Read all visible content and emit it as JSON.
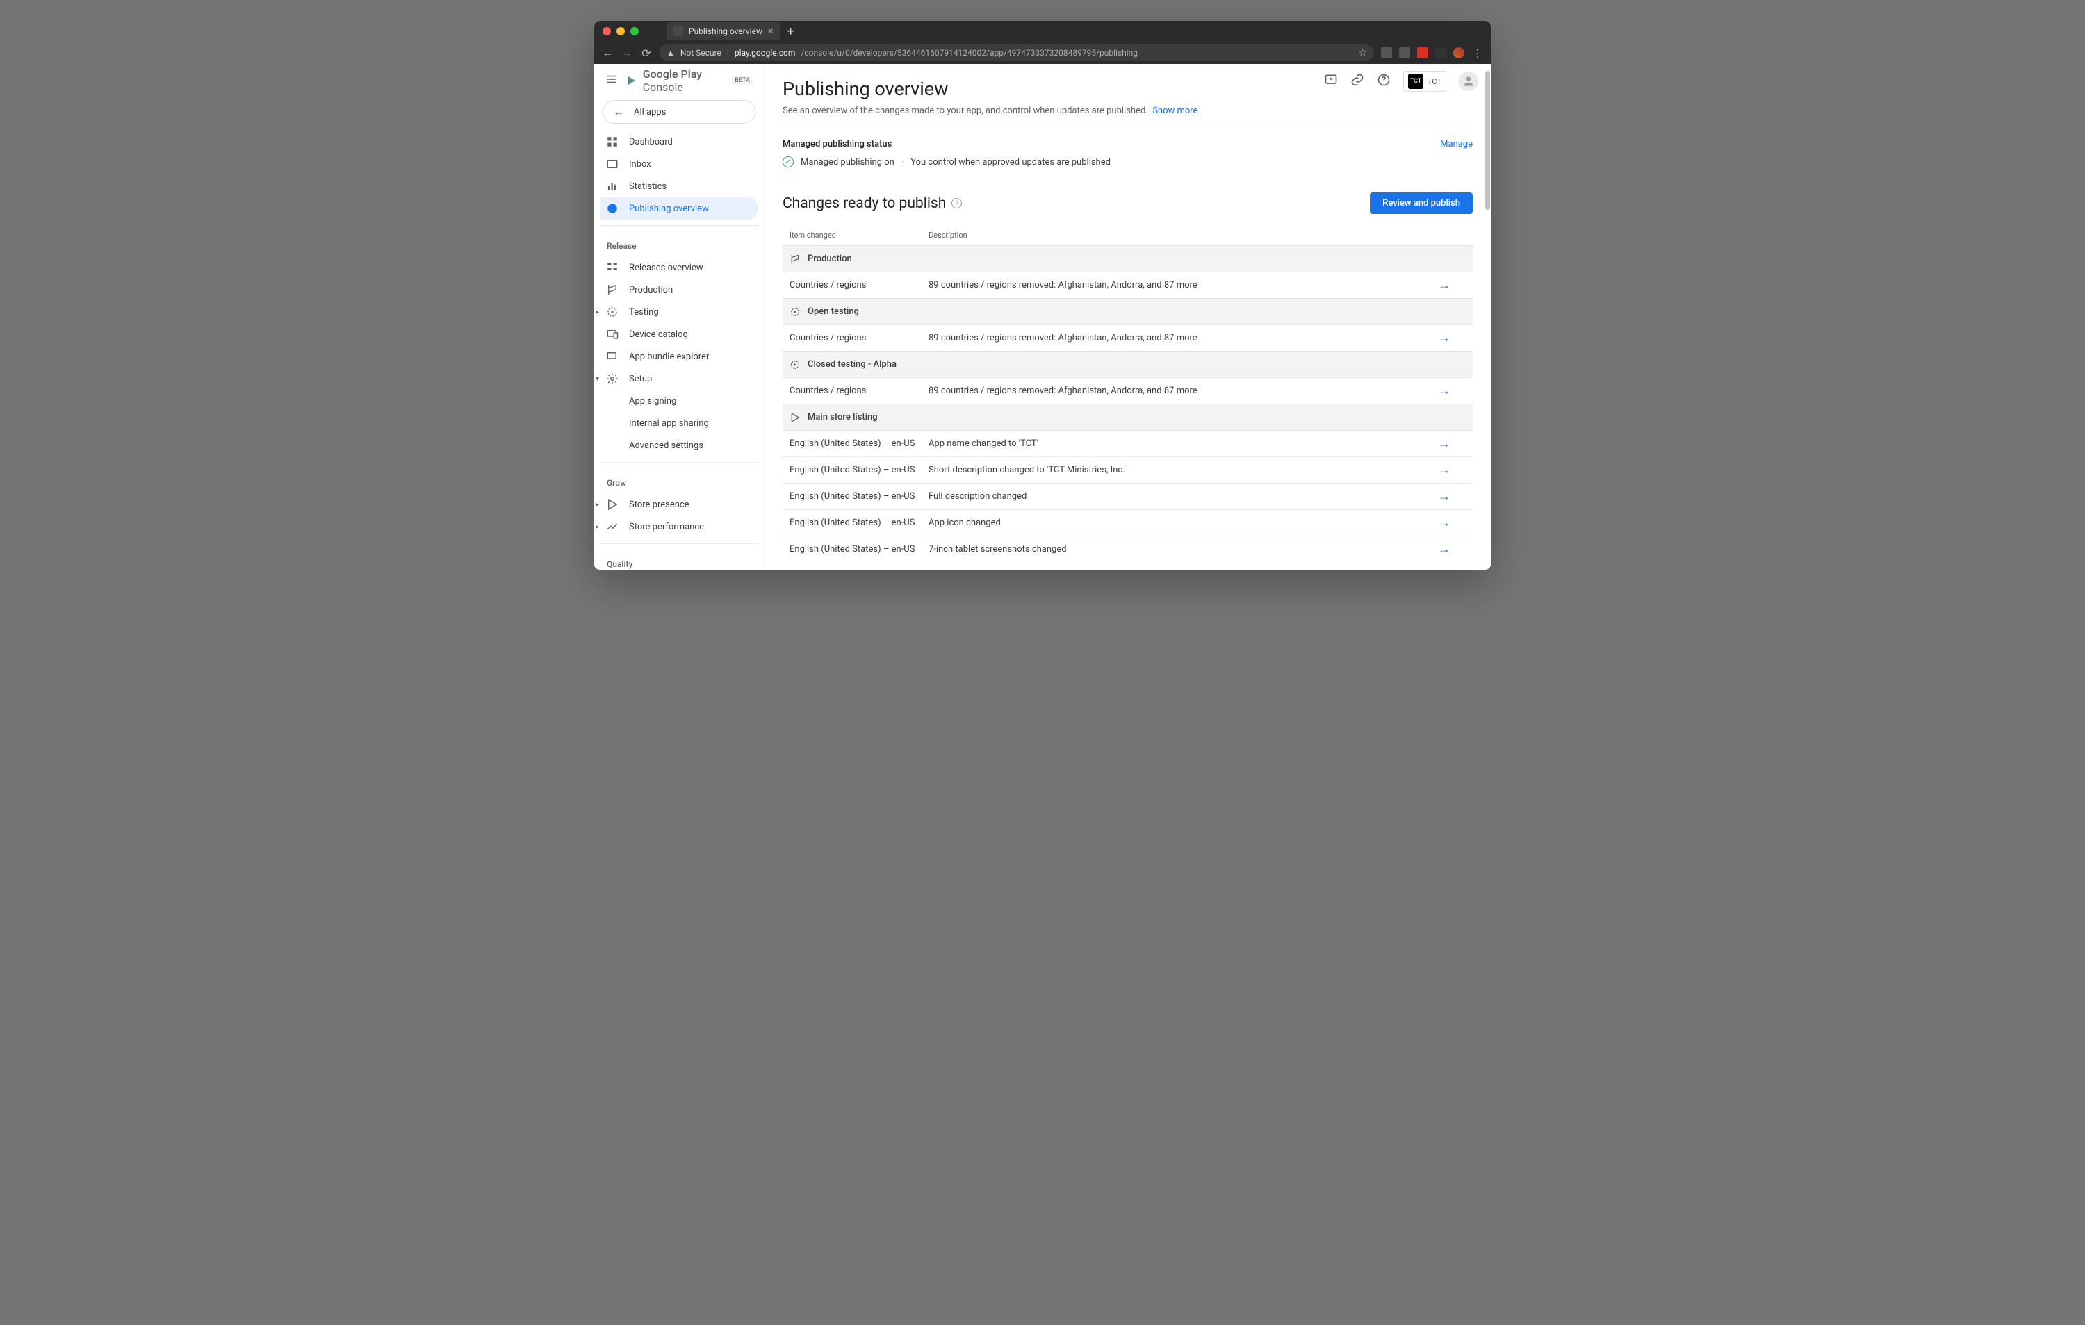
{
  "browser": {
    "tab_title": "Publishing overview",
    "security": "Not Secure",
    "url_domain": "play.google.com",
    "url_path": "/console/u/0/developers/5364461607914124002/app/4974733373208489795/publishing"
  },
  "header": {
    "product": "Google Play",
    "product_sub": "Console",
    "beta": "BETA",
    "all_apps": "All apps",
    "org_name": "TCT",
    "org_badge": "TCT"
  },
  "sidebar": {
    "items": {
      "dashboard": "Dashboard",
      "inbox": "Inbox",
      "statistics": "Statistics",
      "pub_overview": "Publishing overview"
    },
    "sections": {
      "release": "Release",
      "grow": "Grow",
      "quality": "Quality"
    },
    "release": {
      "rel_overview": "Releases overview",
      "production": "Production",
      "testing": "Testing",
      "device_catalog": "Device catalog",
      "bundle_explorer": "App bundle explorer",
      "setup": "Setup",
      "app_signing": "App signing",
      "internal_sharing": "Internal app sharing",
      "adv_settings": "Advanced settings"
    },
    "grow": {
      "store_presence": "Store presence",
      "store_perf": "Store performance"
    }
  },
  "page": {
    "title": "Publishing overview",
    "subtitle": "See an overview of the changes made to your app, and control when updates are published.",
    "show_more": "Show more",
    "status_title": "Managed publishing status",
    "status_on": "Managed publishing on",
    "status_detail": "You control when approved updates are published",
    "manage": "Manage",
    "changes_title": "Changes ready to publish",
    "review_btn": "Review and publish",
    "col_item": "Item changed",
    "col_desc": "Description"
  },
  "groups": [
    {
      "icon": "prod",
      "label": "Production",
      "rows": [
        {
          "item": "Countries / regions",
          "desc": "89 countries / regions removed: Afghanistan, Andorra, and 87 more"
        }
      ]
    },
    {
      "icon": "open",
      "label": "Open testing",
      "rows": [
        {
          "item": "Countries / regions",
          "desc": "89 countries / regions removed: Afghanistan, Andorra, and 87 more"
        }
      ]
    },
    {
      "icon": "closed",
      "label": "Closed testing - Alpha",
      "rows": [
        {
          "item": "Countries / regions",
          "desc": "89 countries / regions removed: Afghanistan, Andorra, and 87 more"
        }
      ]
    },
    {
      "icon": "store",
      "label": "Main store listing",
      "rows": [
        {
          "item": "English (United States) – en-US",
          "desc": "App name changed to 'TCT'"
        },
        {
          "item": "English (United States) – en-US",
          "desc": "Short description changed to 'TCT Ministries, Inc.'"
        },
        {
          "item": "English (United States) – en-US",
          "desc": "Full description changed"
        },
        {
          "item": "English (United States) – en-US",
          "desc": "App icon changed"
        },
        {
          "item": "English (United States) – en-US",
          "desc": "7-inch tablet screenshots changed"
        }
      ]
    }
  ]
}
